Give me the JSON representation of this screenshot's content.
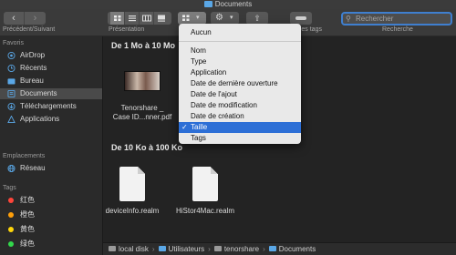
{
  "window": {
    "title": "Documents"
  },
  "toolbar": {
    "nav_label": "Précédent/Suivant",
    "presentation_label": "Présentation",
    "tags_label": "Modifier les tags",
    "search_label": "Recherche",
    "search_placeholder": "Rechercher",
    "back_glyph": "‹",
    "forward_glyph": "›",
    "gear_glyph": "⚙",
    "share_glyph": "⇧",
    "caret_glyph": "▾",
    "search_glyph": "⚲"
  },
  "sidebar": {
    "favorites_header": "Favoris",
    "favorites": [
      {
        "label": "AirDrop",
        "icon": "airdrop-icon"
      },
      {
        "label": "Récents",
        "icon": "clock-icon"
      },
      {
        "label": "Bureau",
        "icon": "desktop-folder-icon"
      },
      {
        "label": "Documents",
        "icon": "documents-folder-icon"
      },
      {
        "label": "Téléchargements",
        "icon": "downloads-icon"
      },
      {
        "label": "Applications",
        "icon": "applications-icon"
      }
    ],
    "locations_header": "Emplacements",
    "locations": [
      {
        "label": "Réseau",
        "icon": "network-icon"
      }
    ],
    "tags_header": "Tags",
    "tags": [
      {
        "label": "红色",
        "color": "#ff453a"
      },
      {
        "label": "橙色",
        "color": "#ff9f0a"
      },
      {
        "label": "黄色",
        "color": "#ffd60a"
      },
      {
        "label": "绿色",
        "color": "#32d74b"
      }
    ]
  },
  "content": {
    "sections": [
      {
        "title": "De 1 Mo à 10 Mo",
        "files": [
          {
            "name_line1": "Tenorshare _",
            "name_line2": "Case ID...nner.pdf"
          }
        ]
      },
      {
        "title": "De 10 Ko à 100 Ko",
        "files": [
          {
            "name_line1": "deviceInfo.realm"
          },
          {
            "name_line1": "HiStor4Mac.realm"
          }
        ]
      }
    ],
    "path": [
      "local disk",
      "Utilisateurs",
      "tenorshare",
      "Documents"
    ],
    "path_separator": "›"
  },
  "sort_menu": {
    "items": [
      "Aucun",
      "Nom",
      "Type",
      "Application",
      "Date de dernière ouverture",
      "Date de l'ajout",
      "Date de modification",
      "Date de création",
      "Taille",
      "Tags"
    ],
    "checked": "Taille",
    "check_glyph": "✓"
  },
  "colors": {
    "accent": "#2d6fd6",
    "folder": "#5aa7e6"
  }
}
